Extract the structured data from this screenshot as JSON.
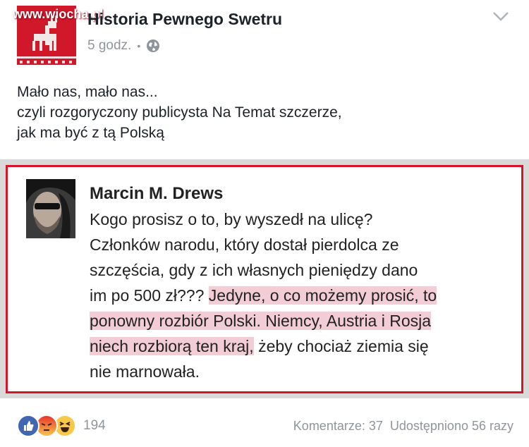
{
  "post": {
    "page_name": "Historia Pewnego Swetru",
    "watermark": "www.wiocha.pl",
    "time": "5 godz.",
    "dot": "•",
    "audience_icon": "globe-icon",
    "menu_icon": "chevron-down-icon",
    "caption_lines": [
      "Mało nas, mało nas...",
      "czyli rozgoryczony publicysta Na Temat szczerze,",
      "jak ma być z tą Polską"
    ]
  },
  "quote": {
    "author": "Marcin M. Drews",
    "line1": "Kogo prosisz o to, by wyszedł na ulicę?",
    "line2": "Członków narodu, który dostał pierdolca ze",
    "line3": "szczęścia, gdy z ich własnych pieniędzy dano",
    "line4_plain": "im po 500 zł??? ",
    "line4_highlight": "Jedyne, o co możemy prosić, to",
    "line5_highlight": "ponowny rozbiór Polski. Niemcy, Austria i Rosja",
    "line6_highlight": "niech rozbiorą ten kraj,",
    "line6_plain": " żeby chociaż ziemia się",
    "line7": "nie marnowała.",
    "colors": {
      "border": "#d3152c",
      "highlight": "#f3cdd6"
    }
  },
  "footer": {
    "reaction_icons": [
      "like-icon",
      "angry-icon",
      "haha-icon"
    ],
    "reaction_count": "194",
    "comments": "Komentarze: 37",
    "shares": "Udostępniono 56 razy"
  }
}
